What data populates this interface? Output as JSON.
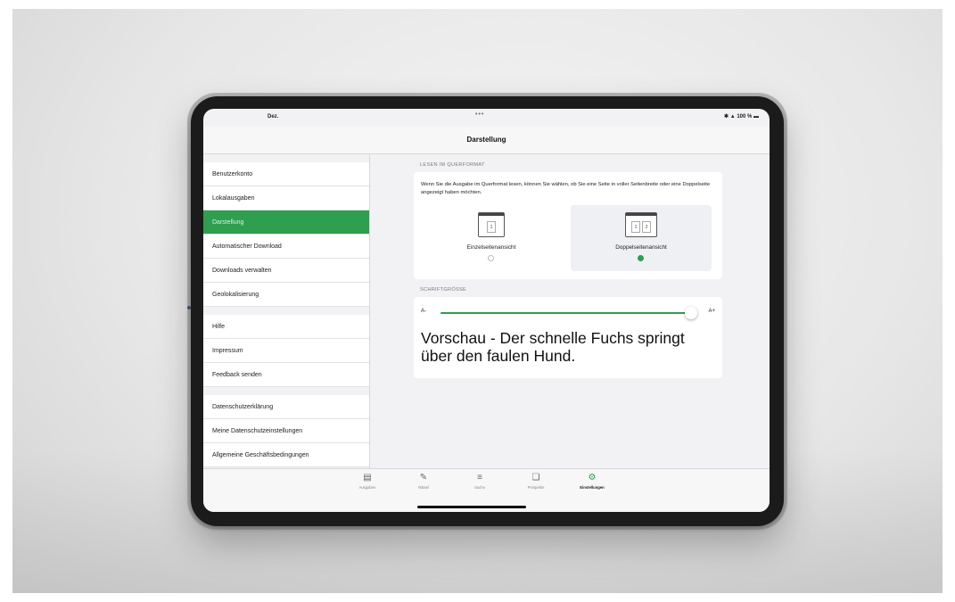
{
  "status": {
    "date": "Dez.",
    "dots": "•••",
    "right": "✱ ▲ 100 % ▬"
  },
  "nav": {
    "title": "Darstellung"
  },
  "sidebar": {
    "groups": [
      [
        "Benutzerkonto",
        "Lokalausgaben",
        "Darstellung",
        "Automatischer Download",
        "Downloads verwalten",
        "Geolokalisierung"
      ],
      [
        "Hilfe",
        "Impressum",
        "Feedback senden"
      ],
      [
        "Datenschutzerklärung",
        "Meine Datenschutzeinstellungen",
        "Allgemeine Geschäftsbedingungen"
      ]
    ],
    "active": "Darstellung"
  },
  "landscape": {
    "header": "LESEN IM QUERFORMAT",
    "description": "Wenn Sie die Ausgabe im Querformat lesen, können Sie wählen, ob Sie eine Seite in voller Seitenbreite oder eine Doppelseite angezeigt haben möchten.",
    "single": {
      "label": "Einzelseitenansicht",
      "page": "1"
    },
    "double": {
      "label": "Doppelseitenansicht",
      "page_left": "1",
      "page_right": "2"
    },
    "selected": "double"
  },
  "font": {
    "header": "SCHRIFTGRÖSSE",
    "min_label": "A-",
    "max_label": "A+",
    "level": 1.0,
    "preview": "Vorschau - Der schnelle Fuchs springt über den faulen Hund."
  },
  "tabs": [
    {
      "label": "Ausgaben",
      "icon": "newspaper-icon"
    },
    {
      "label": "Rätsel",
      "icon": "puzzle-edit-icon"
    },
    {
      "label": "Suche",
      "icon": "search-list-icon"
    },
    {
      "label": "Prospekte",
      "icon": "brochure-icon"
    },
    {
      "label": "Einstellungen",
      "icon": "gear-icon"
    }
  ],
  "active_tab": "Einstellungen",
  "colors": {
    "accent": "#2e9e4f",
    "tablet": "#1b1b1b",
    "background": "#e7e7e7"
  }
}
